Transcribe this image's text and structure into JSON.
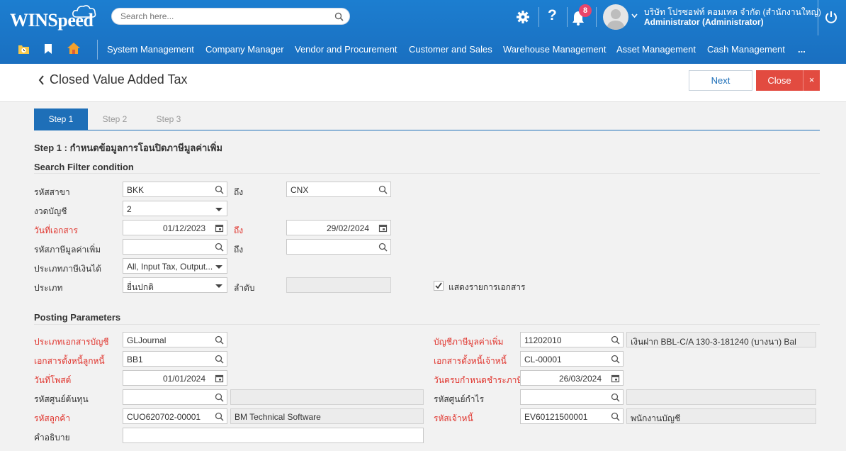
{
  "app": {
    "logo": "WINSpeed"
  },
  "header": {
    "search_placeholder": "Search here...",
    "notification_count": "8",
    "company": "บริษัท โปรซอฟท์ คอมเทค จำกัด (สำนักงานใหญ่)",
    "user": "Administrator (Administrator)"
  },
  "menu": {
    "items": [
      "System Management",
      "Company Manager",
      "Vendor and Procurement",
      "Customer and Sales",
      "Warehouse Management",
      "Asset Management",
      "Cash Management",
      "..."
    ]
  },
  "page": {
    "title": "Closed Value Added Tax",
    "next_label": "Next",
    "close_label": "Close",
    "close_x": "×"
  },
  "steps": {
    "tabs": [
      "Step 1",
      "Step 2",
      "Step 3"
    ],
    "active": 0,
    "heading": "Step 1 : กำหนดข้อมูลการโอนปิดภาษีมูลค่าเพิ่ม"
  },
  "search_filter": {
    "title": "Search Filter condition",
    "branch_label": "รหัสสาขา",
    "branch_from": "BKK",
    "to_label": "ถึง",
    "branch_to": "CNX",
    "period_label": "งวดบัญชี",
    "period_value": "2",
    "docdate_label": "วันที่เอกสาร",
    "docdate_from": "01/12/2023",
    "docdate_to": "29/02/2024",
    "vatcode_label": "รหัสภาษีมูลค่าเพิ่ม",
    "vatcode_from": "",
    "vatcode_to": "",
    "taxtype_label": "ประเภทภาษีเงินได้",
    "taxtype_value": "All, Input Tax, Output...",
    "type_label": "ประเภท",
    "type_value": "ยื่นปกติ",
    "seq_label": "ลำดับ",
    "seq_value": "",
    "show_docs_label": "แสดงรายการเอกสาร",
    "show_docs_checked": true
  },
  "posting": {
    "title": "Posting Parameters",
    "doctype_label": "ประเภทเอกสารบัญชี",
    "doctype_value": "GLJournal",
    "vat_acct_label": "บัญชีภาษีมูลค่าเพิ่ม",
    "vat_acct_code": "11202010",
    "vat_acct_name": "เงินฝาก BBL-C/A 130-3-181240 (บางนา) Bal",
    "ar_doc_label": "เอกสารตั้งหนี้ลูกหนี้",
    "ar_doc_value": "BB1",
    "ap_doc_label": "เอกสารตั้งหนี้เจ้าหนี้",
    "ap_doc_value": "CL-00001",
    "post_date_label": "วันที่โพสต์",
    "post_date_value": "01/01/2024",
    "due_date_label": "วันครบกำหนดชำระภาษี",
    "due_date_value": "26/03/2024",
    "cost_center_label": "รหัสศูนย์ต้นทุน",
    "cost_center_code": "",
    "cost_center_name": "",
    "profit_center_label": "รหัสศูนย์กำไร",
    "profit_center_code": "",
    "profit_center_name": "",
    "customer_label": "รหัสลูกค้า",
    "customer_code": "CUO620702-00001",
    "customer_name": "BM Technical Software",
    "creditor_label": "รหัสเจ้าหนี้",
    "creditor_code": "EV60121500001",
    "creditor_name": "พนักงานบัญชี",
    "desc_label": "คำอธิบาย",
    "desc_value": ""
  },
  "colors": {
    "primary": "#1e6fb8",
    "danger": "#e24b40",
    "required": "#e0332c"
  }
}
